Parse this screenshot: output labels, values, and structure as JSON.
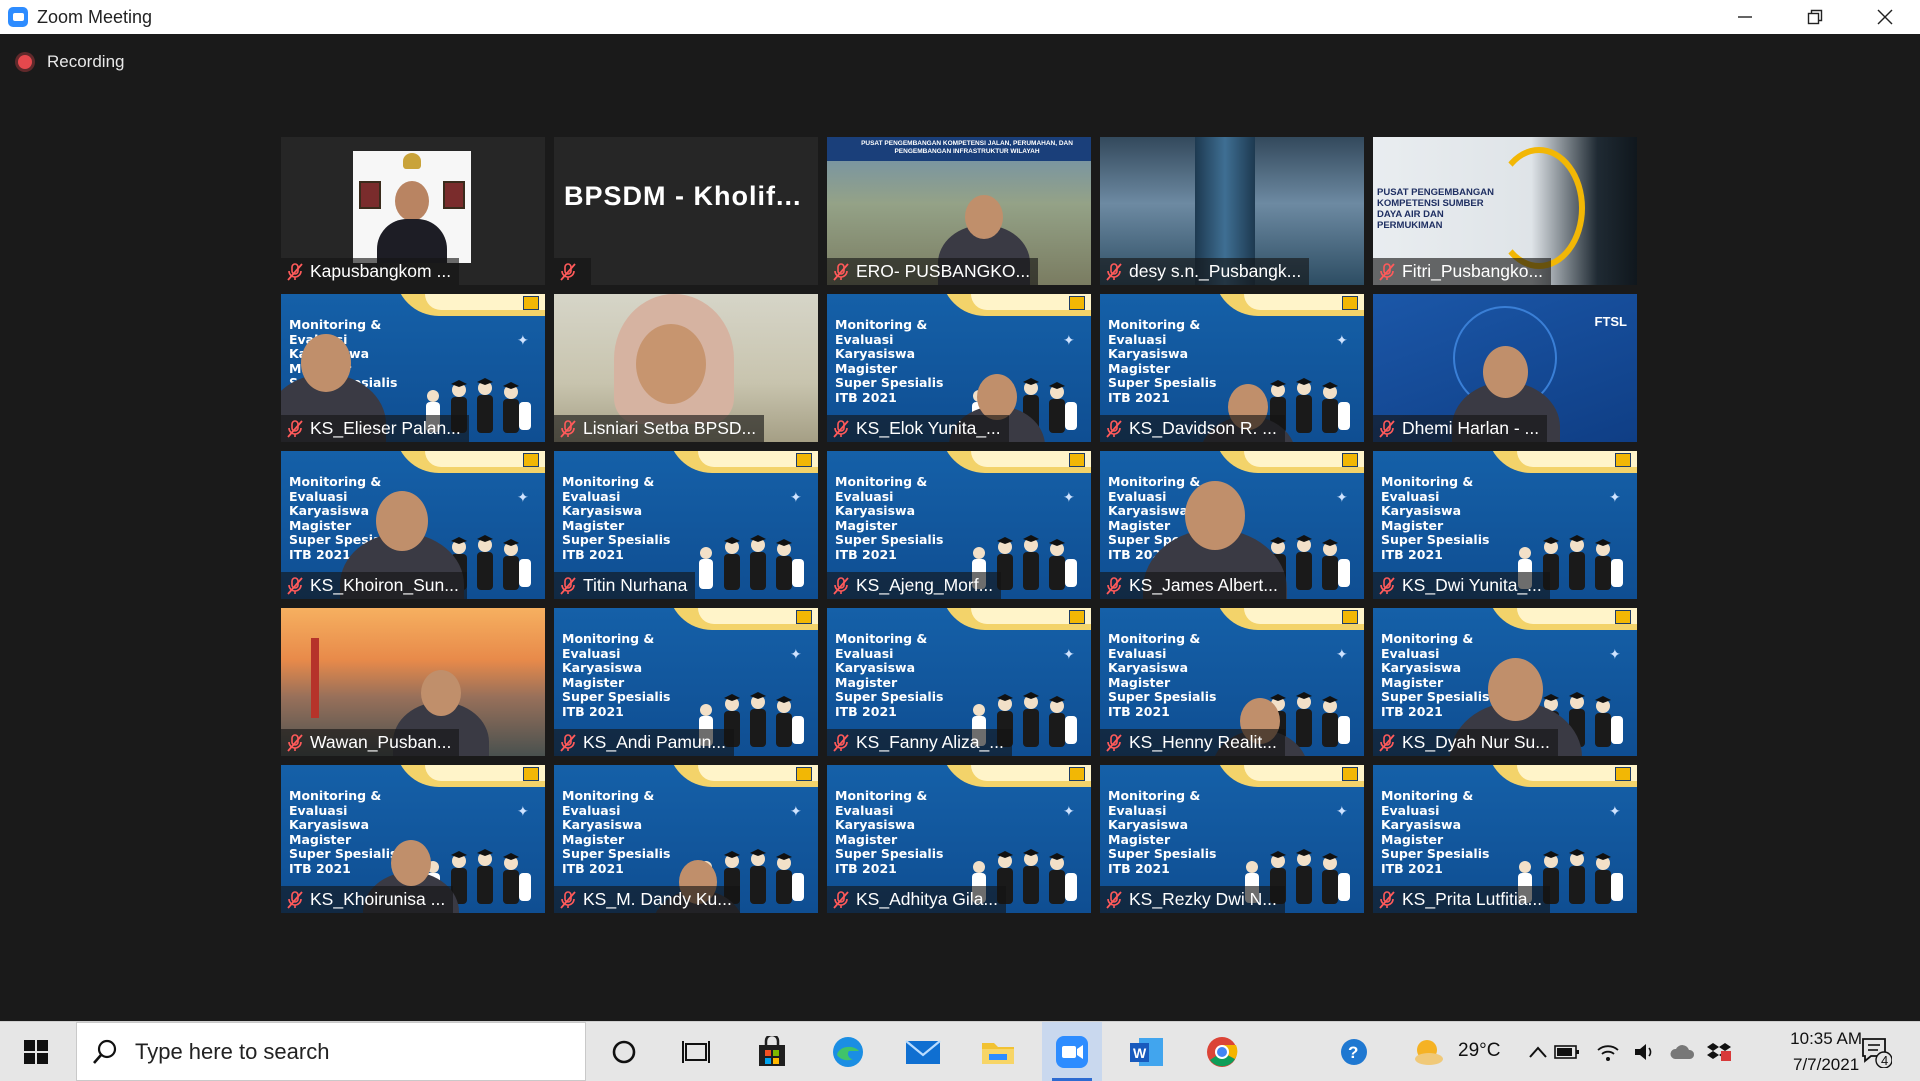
{
  "window": {
    "title": "Zoom Meeting"
  },
  "recording": {
    "label": "Recording"
  },
  "banner": {
    "lines": [
      "Monitoring &",
      "Evaluasi",
      "Karyasiswa",
      "Magister",
      "Super Spesialis",
      "ITB 2021"
    ]
  },
  "tiles": [
    {
      "name": "Kapusbangkom ...",
      "type": "portrait"
    },
    {
      "name": "BPSDM - Kholif...",
      "type": "text-only",
      "mic_muted": true
    },
    {
      "name": "ERO- PUSBANGKO...",
      "type": "photo-ero"
    },
    {
      "name": "desy s.n._Pusbangk...",
      "type": "photo-desy"
    },
    {
      "name": "Fitri_Pusbangko...",
      "type": "photo-fitri"
    },
    {
      "name": "KS_Elieser Palan...",
      "type": "banner"
    },
    {
      "name": "Lisniari Setba BPSD...",
      "type": "photo-lisniari",
      "active_speaker": true
    },
    {
      "name": "KS_Elok Yunita_...",
      "type": "banner"
    },
    {
      "name": "KS_Davidson R. ...",
      "type": "banner"
    },
    {
      "name": "Dhemi Harlan - ...",
      "type": "photo-dhemi"
    },
    {
      "name": "KS_Khoiron_Sun...",
      "type": "banner"
    },
    {
      "name": "Titin Nurhana",
      "type": "banner"
    },
    {
      "name": "KS_Ajeng_Morf...",
      "type": "banner"
    },
    {
      "name": "KS_James Albert...",
      "type": "banner"
    },
    {
      "name": "KS_Dwi Yunita_...",
      "type": "banner"
    },
    {
      "name": "Wawan_Pusban...",
      "type": "photo-wawan"
    },
    {
      "name": "KS_Andi Pamun...",
      "type": "banner"
    },
    {
      "name": "KS_Fanny Aliza_...",
      "type": "banner"
    },
    {
      "name": "KS_Henny Realit...",
      "type": "banner"
    },
    {
      "name": "KS_Dyah Nur Su...",
      "type": "banner"
    },
    {
      "name": "KS_Khoirunisa ...",
      "type": "banner"
    },
    {
      "name": "KS_M. Dandy Ku...",
      "type": "banner"
    },
    {
      "name": "KS_Adhitya Gila...",
      "type": "banner"
    },
    {
      "name": "KS_Rezky Dwi N...",
      "type": "banner"
    },
    {
      "name": "KS_Prita Lutfitia...",
      "type": "banner"
    }
  ],
  "tile_extra": {
    "ero_banner": "PUSAT PENGEMBANGAN KOMPETENSI JALAN, PERUMAHAN, DAN PENGEMBANGAN INFRASTRUKTUR WILAYAH",
    "fitri_banner": "PUSAT PENGEMBANGAN KOMPETENSI SUMBER DAYA AIR DAN PERMUKIMAN",
    "dhemi_logo": "FTSL"
  },
  "taskbar": {
    "search_placeholder": "Type here to search",
    "weather": "29°C",
    "time": "10:35 AM",
    "date": "7/7/2021",
    "notification_count": "4"
  },
  "colors": {
    "accent": "#2d8cff",
    "active_speaker": "#9be03a",
    "recording": "#e5484d"
  }
}
